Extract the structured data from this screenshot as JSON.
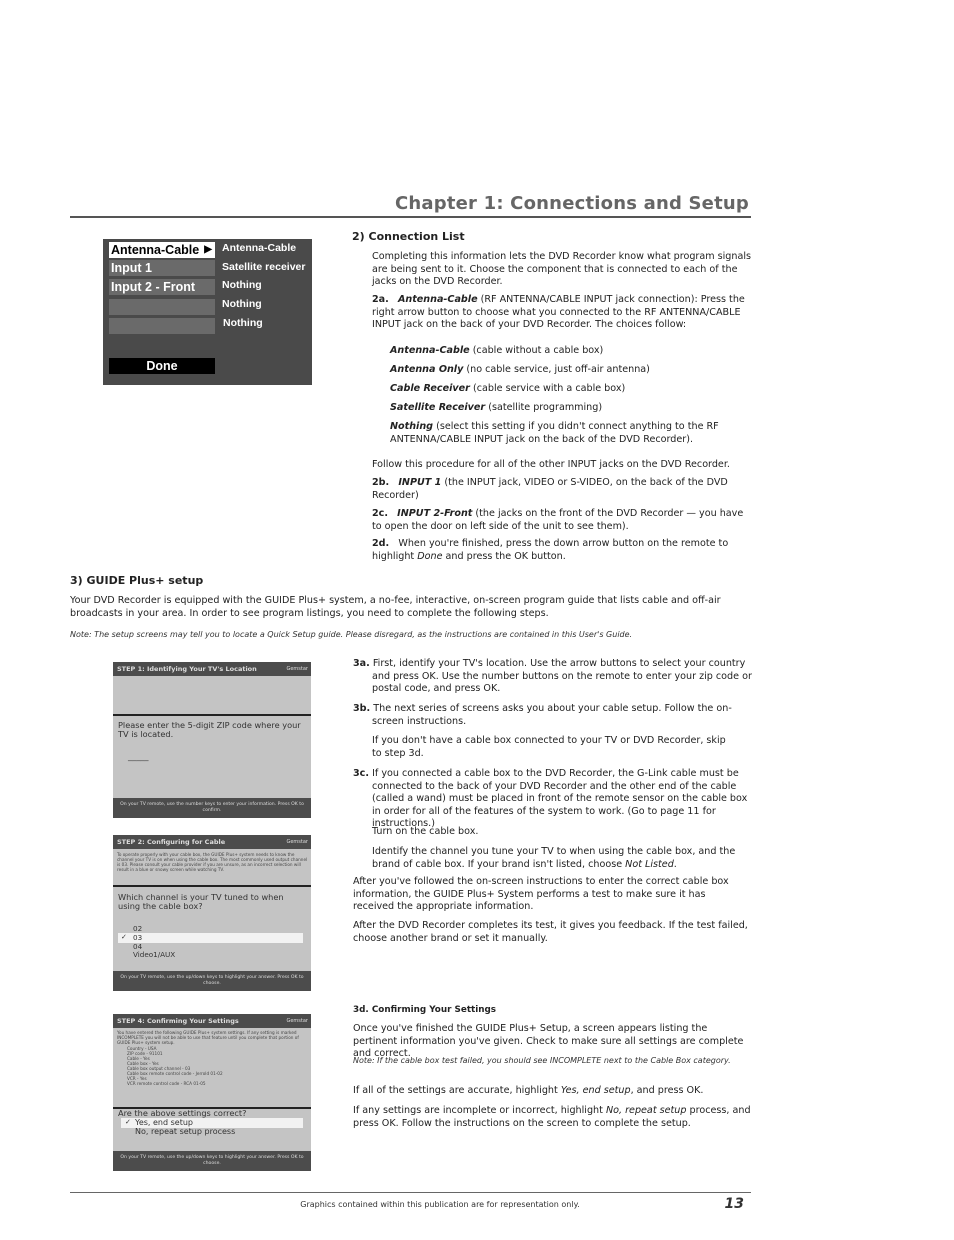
{
  "header": {
    "chapter_title": "Chapter 1: Connections and Setup"
  },
  "connection_screen": {
    "inputs": [
      {
        "label": "Antenna-Cable",
        "value": "Antenna-Cable",
        "selected": true
      },
      {
        "label": "Input 1",
        "value": "Satellite receiver"
      },
      {
        "label": "Input 2 - Front",
        "value": "Nothing"
      },
      {
        "label": "",
        "value": "Nothing"
      },
      {
        "label": "",
        "value": "Nothing"
      }
    ],
    "arrow_icon": "right-triangle-icon",
    "done_label": "Done"
  },
  "section2": {
    "heading": "2) Connection List",
    "intro": "Completing this information lets the DVD Recorder know what program signals are being sent to it. Choose the component that is connected to each of the jacks on the DVD Recorder.",
    "step2a": {
      "num": "2a.",
      "term": "Antenna-Cable",
      "text": " (RF ANTENNA/CABLE INPUT jack connection): Press the right arrow button to choose what you connected to the RF ANTENNA/CABLE INPUT jack on the back of your DVD Recorder. The choices follow:"
    },
    "choices": [
      {
        "term": "Antenna-Cable",
        "desc": " (cable without a cable box)"
      },
      {
        "term": "Antenna Only",
        "desc": " (no cable service, just off-air antenna)"
      },
      {
        "term": "Cable Receiver",
        "desc": " (cable service with a cable box)"
      },
      {
        "term": "Satellite Receiver",
        "desc": " (satellite programming)"
      },
      {
        "term": "Nothing",
        "desc": " (select this setting if you didn't connect anything to the RF ANTENNA/CABLE INPUT jack on the back of the DVD Recorder)."
      }
    ],
    "follow": "Follow this procedure for all of the other INPUT jacks on the DVD Recorder.",
    "step2b": {
      "num": "2b.",
      "term": "INPUT 1",
      "text": " (the INPUT jack, VIDEO or S-VIDEO, on the back of the DVD Recorder)"
    },
    "step2c": {
      "num": "2c.",
      "term": "INPUT 2-Front",
      "text": " (the jacks on the front of the DVD Recorder — you have to open the door on left side of the unit to see them)."
    },
    "step2d": {
      "num": "2d.",
      "text_before": "When you're finished, press the down arrow button on the remote to highlight ",
      "italic": "Done",
      "text_after": " and press the OK button."
    }
  },
  "section3": {
    "heading": "3) GUIDE Plus+ setup",
    "intro": "Your DVD Recorder is equipped with the GUIDE Plus+ system, a no-fee, interactive, on-screen program guide that lists cable and off-air broadcasts in your area. In order to see program listings, you need to complete the following steps.",
    "note": "Note: The setup screens may tell you to locate a Quick Setup guide. Please disregard, as the instructions are contained in this User's Guide.",
    "step3a": {
      "num": "3a.",
      "text": "First, identify your TV's location. Use the arrow buttons to select your country and press OK. Use the number buttons on the remote to enter your zip code or postal code, and press OK."
    },
    "step3b": {
      "num": "3b.",
      "text": "The next series of screens asks you about your cable setup. Follow the on-screen instructions.",
      "text2": "If you don't have a cable box connected to your TV or DVD Recorder, skip to step 3d."
    },
    "step3c": {
      "num": "3c.",
      "text": "If you connected a cable box to the DVD Recorder, the G-Link cable must be connected to the back of your DVD Recorder and the other end of the cable (called a wand) must be placed in front of the remote sensor on the cable box in order for all of the features of the system to work. (Go to page 11 for instructions.)",
      "text2": "Turn on the cable box.",
      "text3_before": "Identify the channel you tune your TV to when using the cable box, and the brand of cable box. If your brand isn't listed, choose ",
      "text3_italic": "Not Listed",
      "text3_after": "."
    },
    "after1": "After you've followed the on-screen instructions to enter the correct cable box information, the GUIDE Plus+ System performs a test to make sure it has received the appropriate information.",
    "after2": "After the DVD Recorder completes its test, it gives you feedback. If the test failed, choose another brand or set it manually.",
    "step3d": {
      "heading": "3d. Confirming Your Settings",
      "text": "Once you've finished the GUIDE Plus+ Setup, a screen appears listing the pertinent information you've given. Check to make sure all settings are complete and correct.",
      "note": "Note: If the cable box test failed, you should see INCOMPLETE next to the Cable Box category.",
      "yes_before": "If all of the settings are accurate, highlight ",
      "yes_italic": "Yes, end setup",
      "yes_after": ", and press OK.",
      "no_before": "If any settings are incomplete or incorrect, highlight ",
      "no_italic": "No, repeat setup",
      "no_after": " process, and press OK. Follow the instructions on the screen to complete the setup."
    }
  },
  "screens": {
    "step1": {
      "title": "STEP 1: Identifying Your TV's Location",
      "brand": "Gemstar",
      "question": "Please enter the 5-digit ZIP code where your TV is located.",
      "entry": "_____",
      "footer": "On your TV remote, use the number keys to enter your information. Press OK to confirm."
    },
    "step2": {
      "title": "STEP 2: Configuring for Cable",
      "brand": "Gemstar",
      "info": "To operate properly with your cable box, the GUIDE Plus+ system needs to know the channel your TV is on when using the cable box. The most commonly used output channel is 03. Please consult your cable provider if you are unsure, as an incorrect selection will result in a blue or snowy screen while watching TV.",
      "question": "Which channel is your TV tuned to when using the cable box?",
      "options": [
        "02",
        "03",
        "04",
        "Video1/AUX"
      ],
      "selected_index": 1,
      "footer": "On your TV remote, use the up/down keys to highlight your answer. Press OK to choose."
    },
    "step4": {
      "title": "STEP 4: Confirming Your Settings",
      "brand": "Gemstar",
      "info": "You have entered the following GUIDE Plus+ system settings. If any setting is marked INCOMPLETE you will not be able to use that feature until you complete that portion of GUIDE Plus+ system setup.",
      "settings": [
        "Country - USA",
        "ZIP code - 91101",
        "Cable - Yes",
        "Cable box - Yes",
        "Cable box output channel - 03",
        "Cable box remote control code - Jerrold 01-02",
        "VCR - Yes",
        "VCR remote control code - RCA 01-05"
      ],
      "question": "Are the above settings correct?",
      "options": [
        "Yes, end setup",
        "No, repeat setup process"
      ],
      "selected_index": 0,
      "footer": "On your TV remote, use the up/down keys to highlight your answer. Press OK to choose."
    }
  },
  "footer": {
    "disclaimer": "Graphics contained within this publication are for representation only.",
    "page_number": "13"
  }
}
